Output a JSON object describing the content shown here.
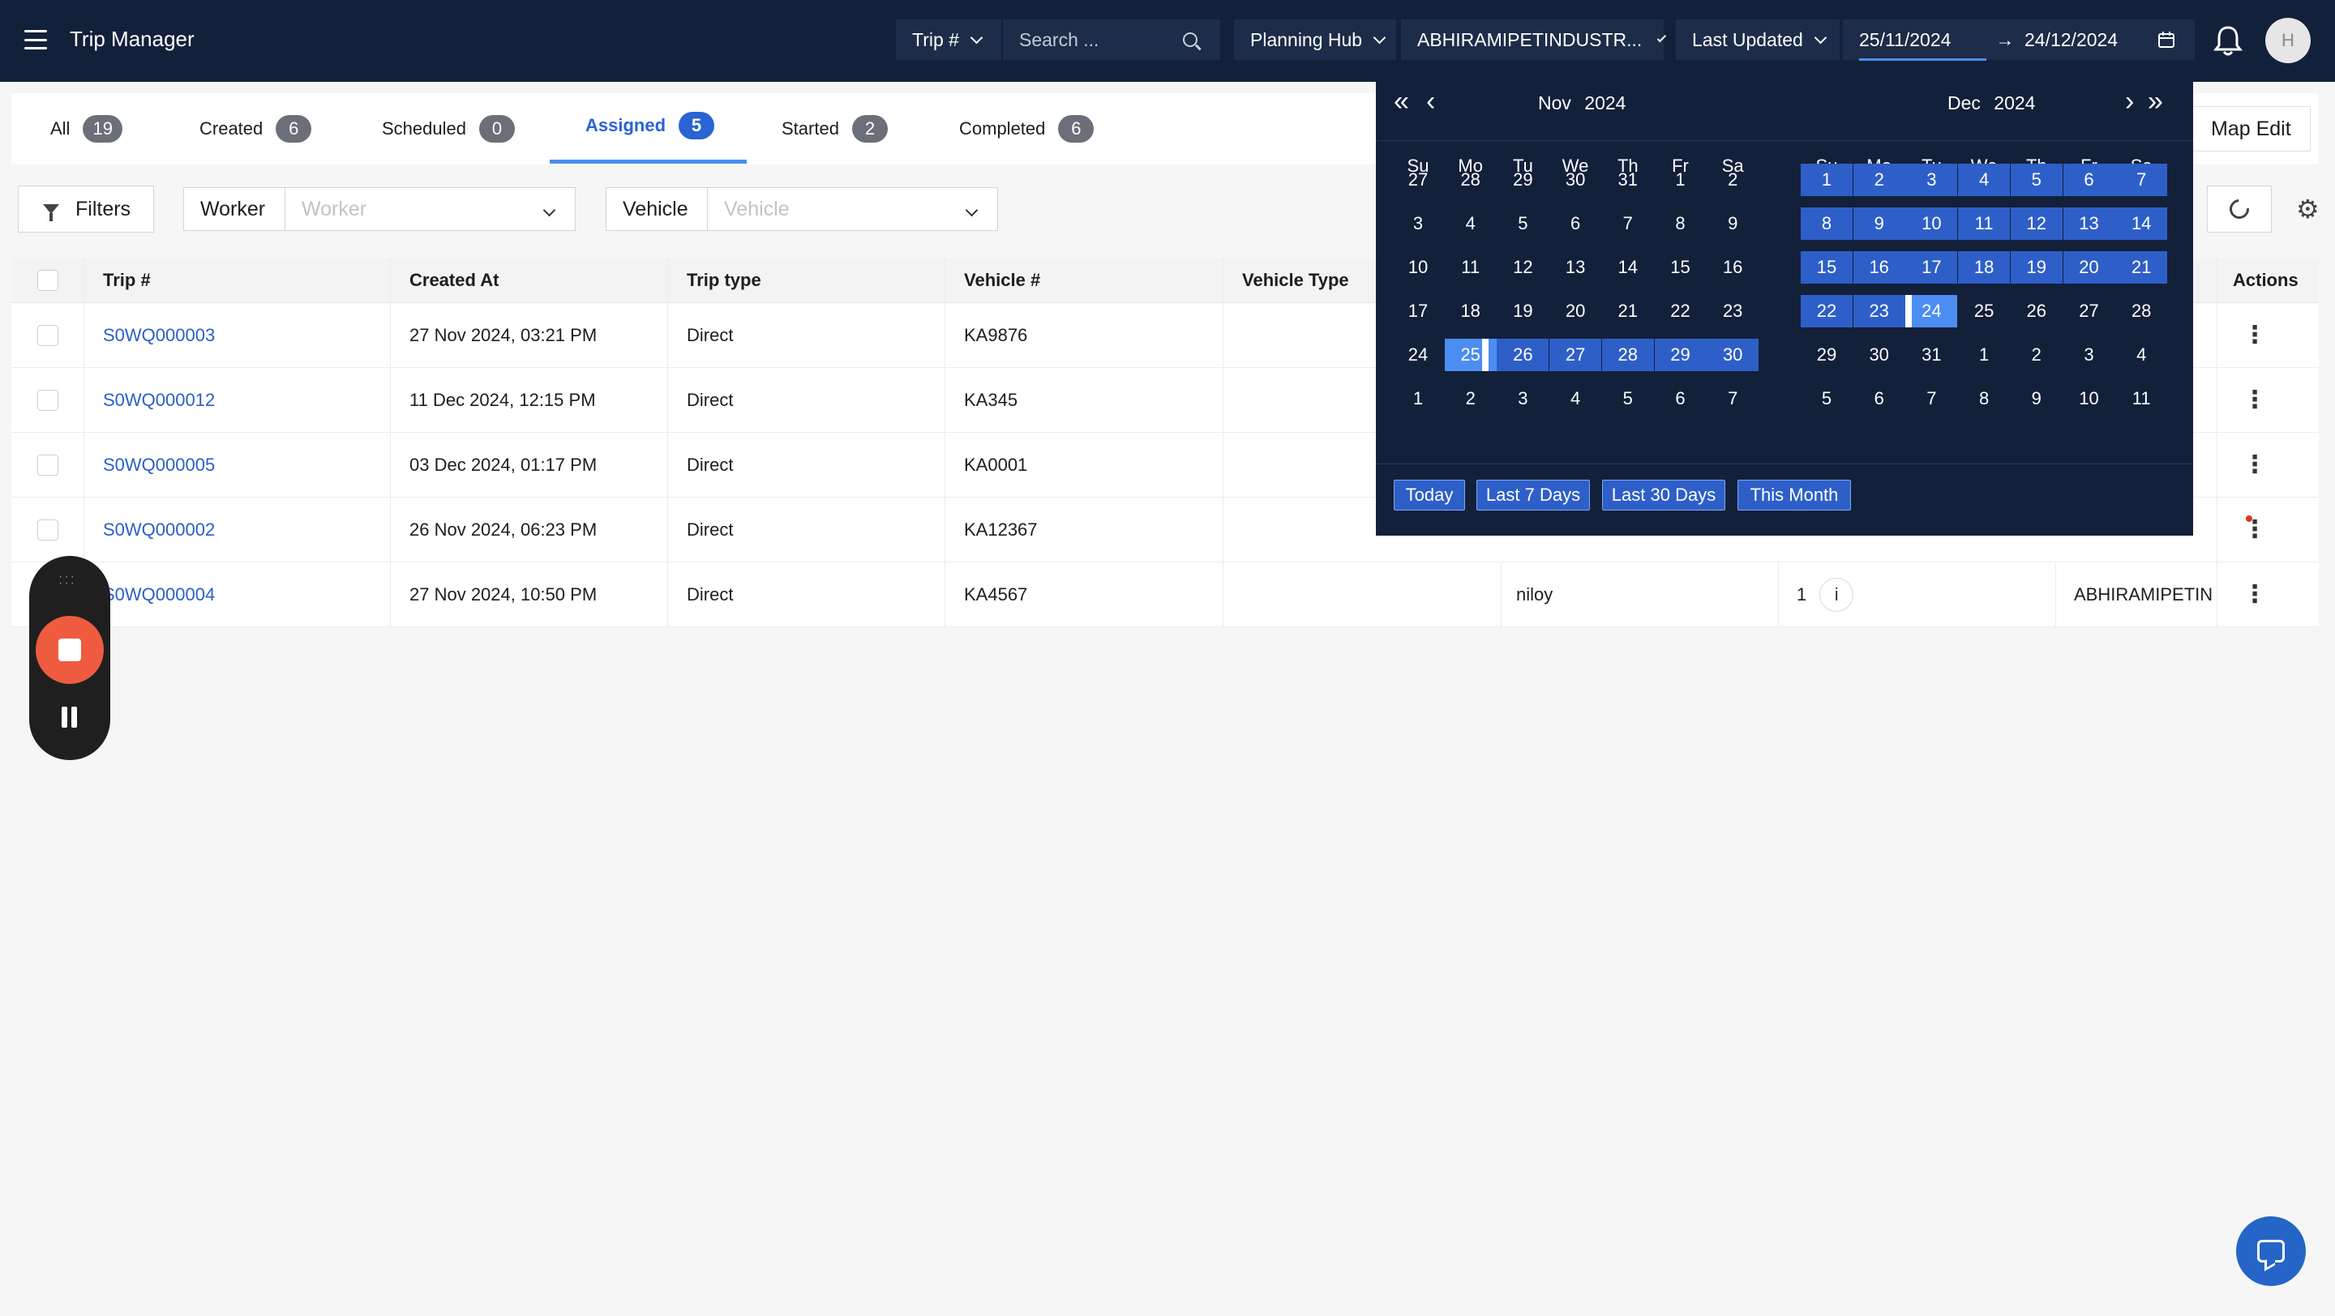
{
  "app": {
    "title": "Trip Manager"
  },
  "header": {
    "trip_filter_label": "Trip #",
    "search_placeholder": "Search ...",
    "hub_label": "Planning Hub",
    "hub_value": "ABHIRAMIPETINDUSTR...",
    "sort_label": "Last Updated",
    "date_from": "25/11/2024",
    "date_arrow": "→",
    "date_to": "24/12/2024",
    "avatar_initial": "H"
  },
  "tabs": [
    {
      "label": "All",
      "count": "19"
    },
    {
      "label": "Created",
      "count": "6"
    },
    {
      "label": "Scheduled",
      "count": "0"
    },
    {
      "label": "Assigned",
      "count": "5"
    },
    {
      "label": "Started",
      "count": "2"
    },
    {
      "label": "Completed",
      "count": "6"
    }
  ],
  "active_tab": "Assigned",
  "map_edit_label": "Map Edit",
  "filters": {
    "filters_label": "Filters",
    "worker_label": "Worker",
    "worker_placeholder": "Worker",
    "vehicle_label": "Vehicle",
    "vehicle_placeholder": "Vehicle"
  },
  "table": {
    "columns": {
      "trip": "Trip #",
      "created_at": "Created At",
      "trip_type": "Trip type",
      "vehicle": "Vehicle #",
      "vehicle_type": "Vehicle Type",
      "actions": "Actions"
    },
    "rows": [
      {
        "trip": "S0WQ000003",
        "created_at": "27 Nov 2024, 03:21 PM",
        "trip_type": "Direct",
        "vehicle": "KA9876"
      },
      {
        "trip": "S0WQ000012",
        "created_at": "11 Dec 2024, 12:15 PM",
        "trip_type": "Direct",
        "vehicle": "KA345"
      },
      {
        "trip": "S0WQ000005",
        "created_at": "03 Dec 2024, 01:17 PM",
        "trip_type": "Direct",
        "vehicle": "KA0001"
      },
      {
        "trip": "S0WQ000002",
        "created_at": "26 Nov 2024, 06:23 PM",
        "trip_type": "Direct",
        "vehicle": "KA12367"
      },
      {
        "trip": "S0WQ000004",
        "created_at": "27 Nov 2024, 10:50 PM",
        "trip_type": "Direct",
        "vehicle": "KA4567",
        "worker": "niloy",
        "count": "1",
        "hub": "ABHIRAMIPETINI"
      }
    ]
  },
  "calendar": {
    "weekdays": [
      "Su",
      "Mo",
      "Tu",
      "We",
      "Th",
      "Fr",
      "Sa"
    ],
    "left": {
      "month": "Nov",
      "year": "2024",
      "days": [
        [
          "27",
          "28",
          "29",
          "30",
          "31",
          "1",
          "2"
        ],
        [
          "3",
          "4",
          "5",
          "6",
          "7",
          "8",
          "9"
        ],
        [
          "10",
          "11",
          "12",
          "13",
          "14",
          "15",
          "16"
        ],
        [
          "17",
          "18",
          "19",
          "20",
          "21",
          "22",
          "23"
        ],
        [
          "24",
          "25",
          "26",
          "27",
          "28",
          "29",
          "30"
        ],
        [
          "1",
          "2",
          "3",
          "4",
          "5",
          "6",
          "7"
        ]
      ]
    },
    "right": {
      "month": "Dec",
      "year": "2024",
      "days": [
        [
          "1",
          "2",
          "3",
          "4",
          "5",
          "6",
          "7"
        ],
        [
          "8",
          "9",
          "10",
          "11",
          "12",
          "13",
          "14"
        ],
        [
          "15",
          "16",
          "17",
          "18",
          "19",
          "20",
          "21"
        ],
        [
          "22",
          "23",
          "24",
          "25",
          "26",
          "27",
          "28"
        ],
        [
          "29",
          "30",
          "31",
          "1",
          "2",
          "3",
          "4"
        ],
        [
          "5",
          "6",
          "7",
          "8",
          "9",
          "10",
          "11"
        ]
      ]
    },
    "presets": [
      "Today",
      "Last 7 Days",
      "Last 30 Days",
      "This Month"
    ]
  },
  "colors": {
    "navy": "#13203a",
    "accent": "#2a63d4",
    "range": "#2e5fc8",
    "endpoint": "#4c8df2",
    "record": "#ef5b3f"
  }
}
